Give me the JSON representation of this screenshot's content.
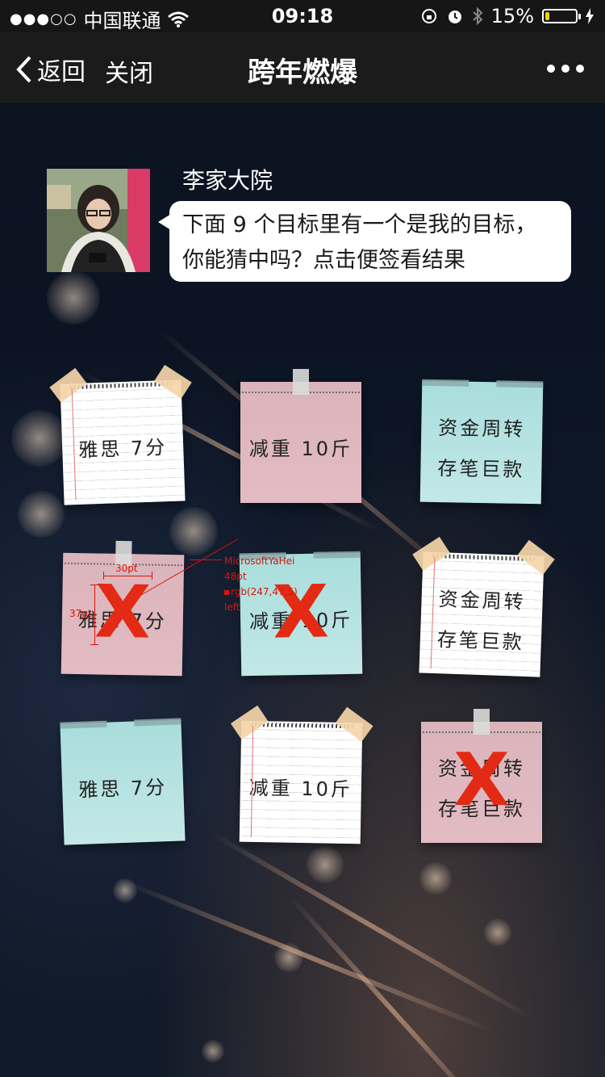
{
  "status_bar": {
    "signal": "●●●○○",
    "carrier": "中国联通",
    "time": "09:18",
    "battery": "15%",
    "battery_level": 0.15
  },
  "nav": {
    "back_label": "返回",
    "close_label": "关闭",
    "title": "跨年燃爆"
  },
  "profile": {
    "name": "李家大院",
    "message_line1": "下面 9 个目标里有一个是我的目标，",
    "message_line2": "你能猜中吗？点击便签看结果"
  },
  "notes": [
    {
      "line1": "雅思 7分",
      "line2": "",
      "style": "lined",
      "crossed": false
    },
    {
      "line1": "减重 10斤",
      "line2": "",
      "style": "pink",
      "crossed": false
    },
    {
      "line1": "资金周转",
      "line2": "存笔巨款",
      "style": "teal",
      "crossed": false
    },
    {
      "line1": "雅思 7分",
      "line2": "",
      "style": "pink",
      "crossed": true
    },
    {
      "line1": "减重 10斤",
      "line2": "",
      "style": "teal",
      "crossed": true
    },
    {
      "line1": "资金周转",
      "line2": "存笔巨款",
      "style": "lined",
      "crossed": false
    },
    {
      "line1": "雅思 7分",
      "line2": "",
      "style": "teal",
      "crossed": false
    },
    {
      "line1": "减重 10斤",
      "line2": "",
      "style": "lined",
      "crossed": false
    },
    {
      "line1": "资金周转",
      "line2": "存笔巨款",
      "style": "pink",
      "crossed": true
    }
  ],
  "cross_symbol": "X",
  "annotation": {
    "width_label": "30pt",
    "height_label": "37pt",
    "font_name": "MicrosoftYaHei",
    "font_size": "48pt",
    "color": "rgb(247,47,5)",
    "align": "left"
  },
  "colors": {
    "cross": "#e32a14",
    "battery": "#f5d000"
  }
}
